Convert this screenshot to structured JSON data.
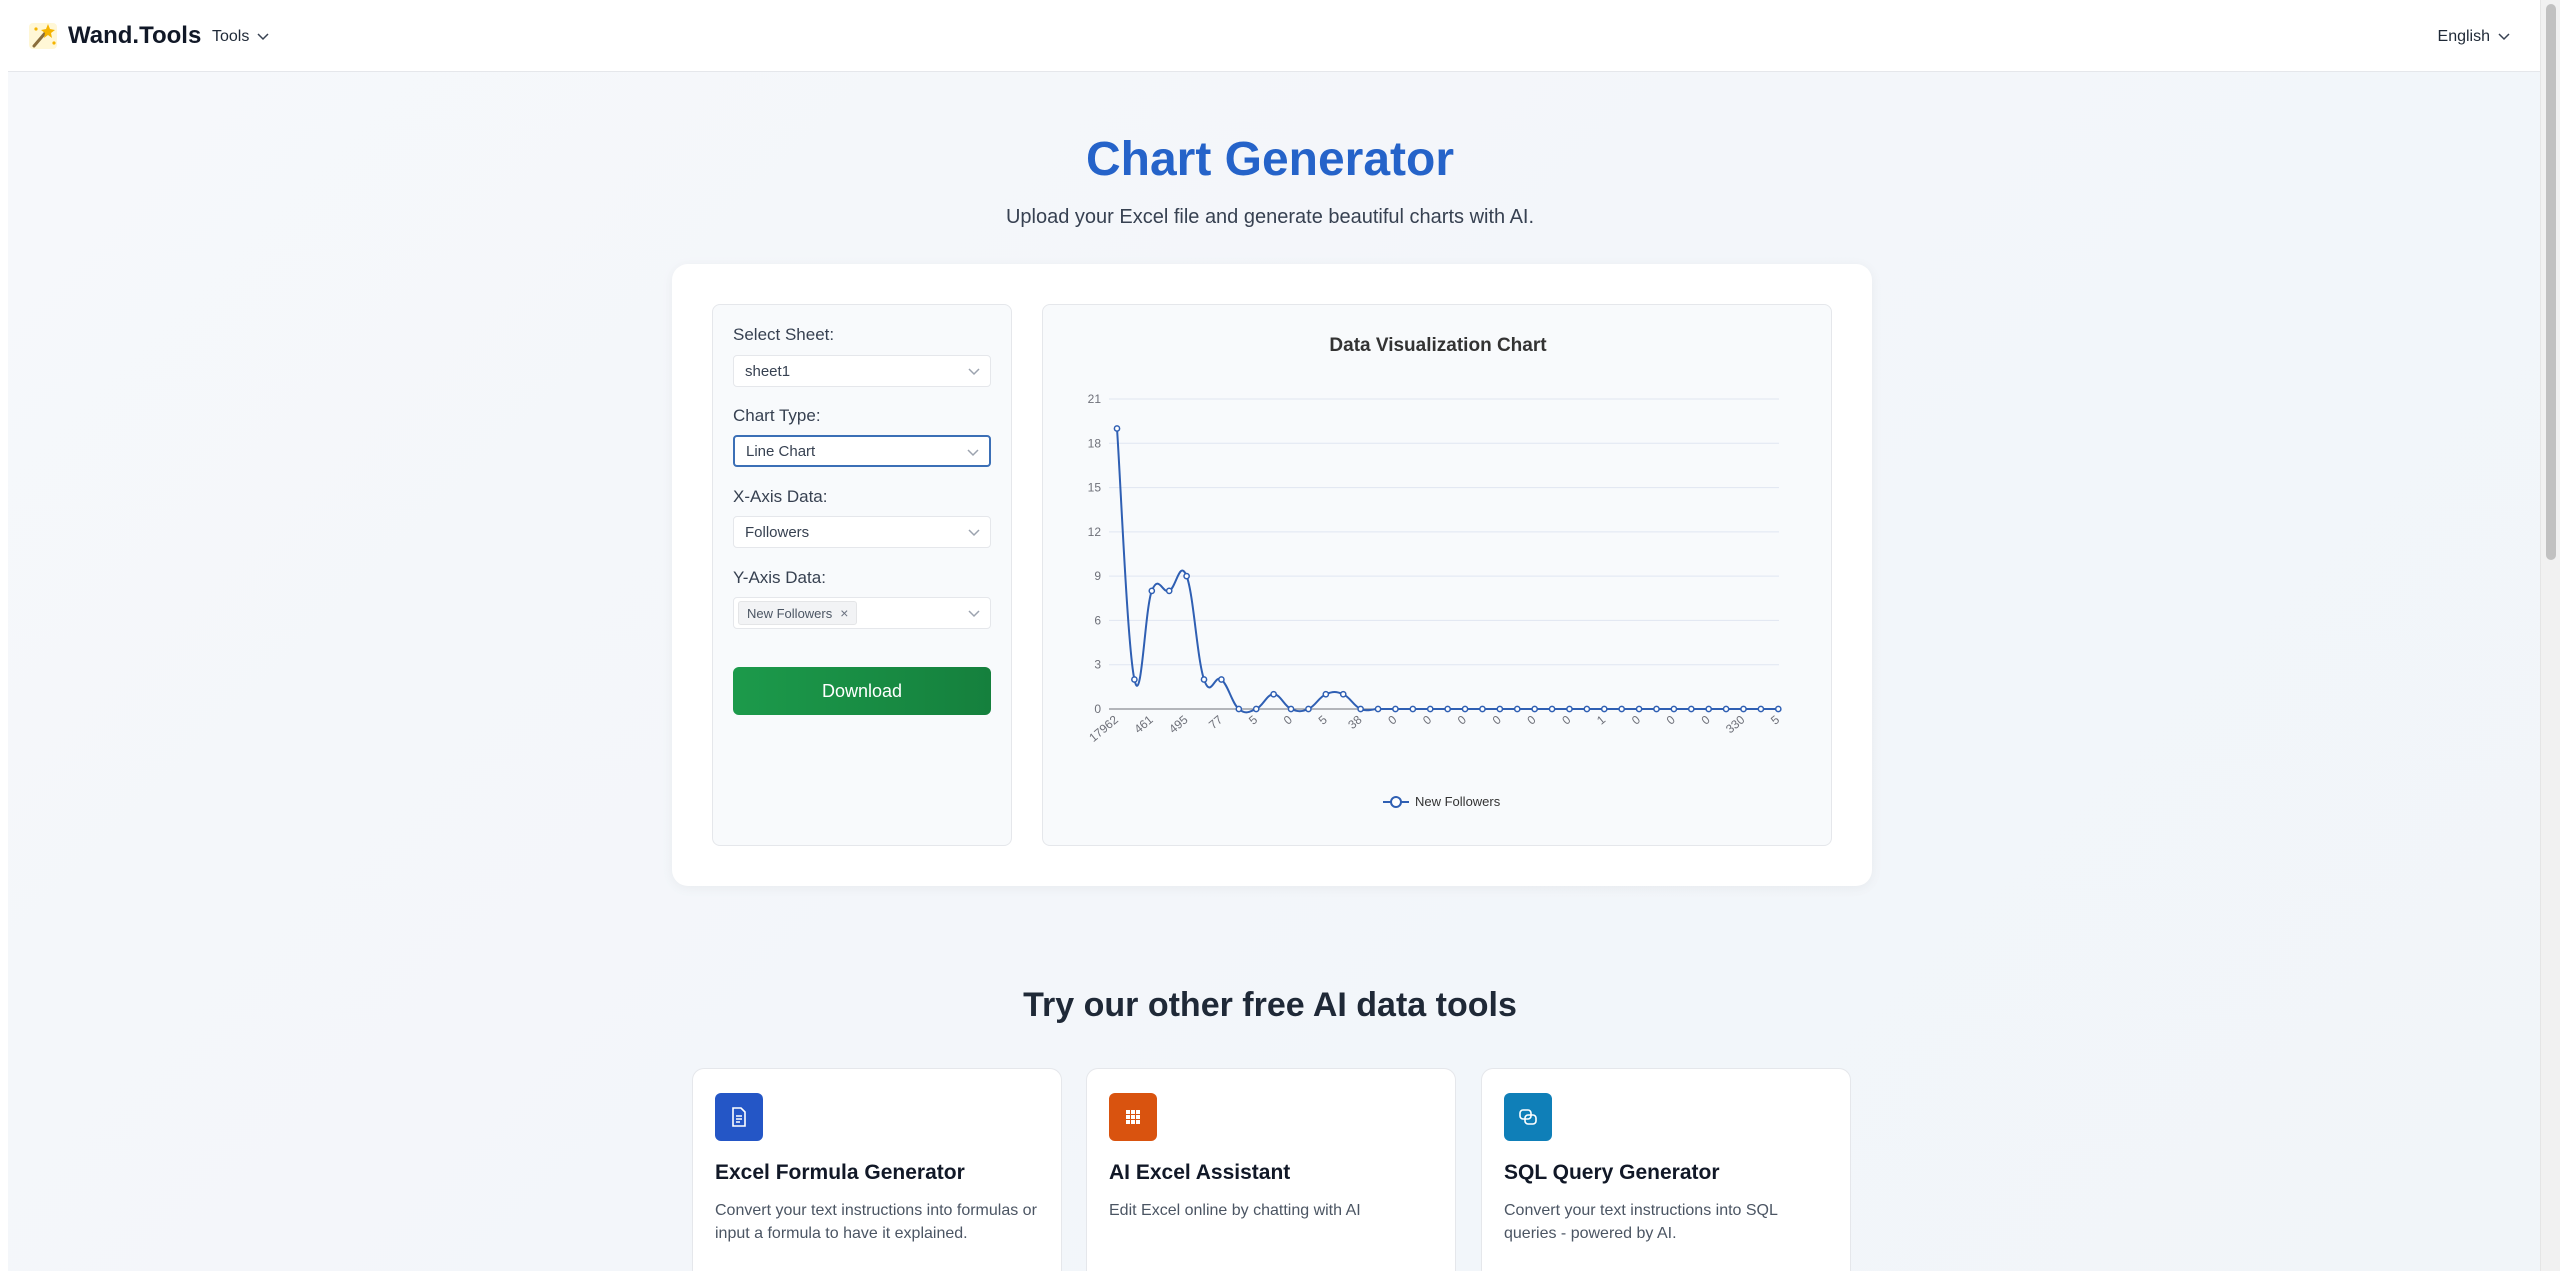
{
  "header": {
    "brand": "Wand.Tools",
    "tools_label": "Tools",
    "language_label": "English"
  },
  "hero": {
    "title": "Chart Generator",
    "subtitle": "Upload your Excel file and generate beautiful charts with AI."
  },
  "controls": {
    "sheet_label": "Select Sheet:",
    "sheet_value": "sheet1",
    "chart_type_label": "Chart Type:",
    "chart_type_value": "Line Chart",
    "x_axis_label": "X-Axis Data:",
    "x_axis_value": "Followers",
    "y_axis_label": "Y-Axis Data:",
    "y_axis_tag": "New Followers",
    "tag_remove": "×",
    "download_label": "Download"
  },
  "chart_data": {
    "type": "line",
    "title": "Data Visualization Chart",
    "x_tick_labels": [
      "17962",
      "461",
      "495",
      "77",
      "5",
      "0",
      "5",
      "38",
      "0",
      "0",
      "0",
      "0",
      "0",
      "0",
      "1",
      "0",
      "0",
      "0",
      "330",
      "5"
    ],
    "y_ticks": [
      0,
      3,
      6,
      9,
      12,
      15,
      18,
      21
    ],
    "ylim": [
      0,
      21
    ],
    "series": [
      {
        "name": "New Followers",
        "color": "#2f5fb3",
        "values": [
          19,
          2,
          8,
          8,
          9,
          2,
          2,
          0,
          0,
          1,
          0,
          0,
          1,
          1,
          0,
          0,
          0,
          0,
          0,
          0,
          0,
          0,
          0,
          0,
          0,
          0,
          0,
          0,
          0,
          0,
          0,
          0,
          0,
          0,
          0,
          0,
          0,
          0,
          0
        ]
      }
    ],
    "legend": "bottom-center",
    "grid": true
  },
  "tools_section": {
    "title": "Try our other free AI data tools",
    "cards": [
      {
        "name": "Excel Formula Generator",
        "desc": "Convert your text instructions into formulas or input a formula to have it explained.",
        "color": "#2456c6"
      },
      {
        "name": "AI Excel Assistant",
        "desc": "Edit Excel online by chatting with AI",
        "color": "#d9530f"
      },
      {
        "name": "SQL Query Generator",
        "desc": "Convert your text instructions into SQL queries - powered by AI.",
        "color": "#0f7fb8"
      }
    ]
  }
}
